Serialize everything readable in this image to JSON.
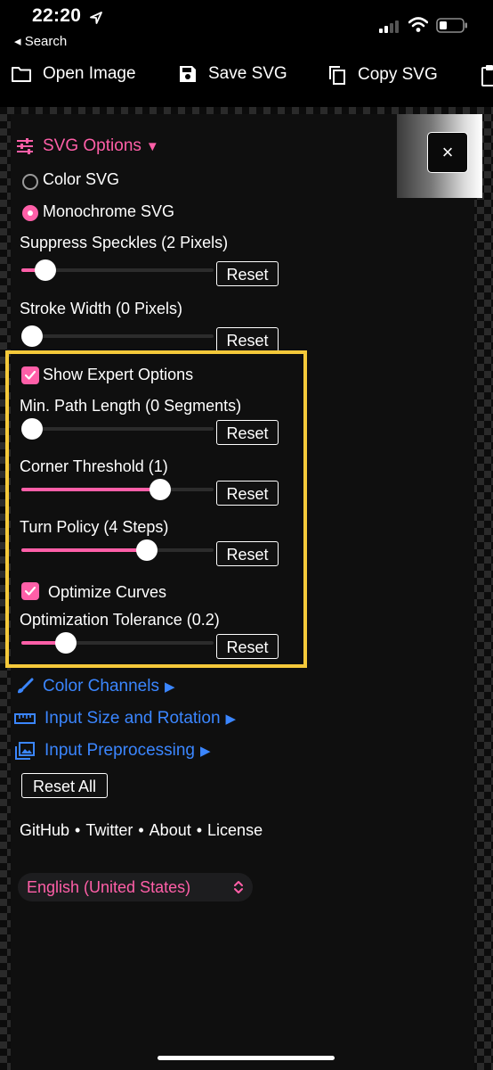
{
  "status_bar": {
    "time": "22:20",
    "back_label": "◂ Search"
  },
  "toolbar": {
    "open_image": "Open Image",
    "save_svg": "Save SVG",
    "copy_svg": "Copy SVG"
  },
  "svg_options": {
    "title": "SVG Options",
    "expand_glyph": "▼",
    "color_svg": "Color SVG",
    "monochrome_svg": "Monochrome SVG",
    "selected_mode": "Monochrome SVG",
    "close_glyph": "×",
    "suppress_speckles": {
      "label": "Suppress Speckles (2 Pixels)",
      "value_fraction": 0.08,
      "reset": "Reset"
    },
    "stroke_width": {
      "label": "Stroke Width (0 Pixels)",
      "value_fraction": 0.0,
      "reset": "Reset"
    },
    "show_expert": {
      "label": "Show Expert Options",
      "checked": true
    },
    "min_path_length": {
      "label": "Min. Path Length (0 Segments)",
      "value_fraction": 0.0,
      "reset": "Reset"
    },
    "corner_threshold": {
      "label": "Corner Threshold (1)",
      "value_fraction": 0.75,
      "reset": "Reset"
    },
    "turn_policy": {
      "label": "Turn Policy (4 Steps)",
      "value_fraction": 0.67,
      "reset": "Reset"
    },
    "optimize_curves": {
      "label": "Optimize Curves",
      "checked": true
    },
    "optimization_tolerance": {
      "label": "Optimization Tolerance (0.2)",
      "value_fraction": 0.2,
      "reset": "Reset"
    }
  },
  "sections": {
    "color_channels": "Color Channels",
    "input_size_rotation": "Input Size and Rotation",
    "input_preprocessing": "Input Preprocessing",
    "collapsed_glyph": "▶"
  },
  "reset_all": "Reset All",
  "footer": {
    "links": [
      "GitHub",
      "Twitter",
      "About",
      "License"
    ],
    "separator": "•"
  },
  "language": {
    "selected": "English (United States)"
  },
  "colors": {
    "accent": "#ff5fa8",
    "link_blue": "#3b86ff",
    "highlight": "#f5c93a"
  },
  "icons": {
    "status": [
      "location-arrow-icon",
      "signal-icon",
      "wifi-icon",
      "battery-icon"
    ],
    "toolbar": [
      "folder-icon",
      "save-icon",
      "copy-icon",
      "clipboard-icon"
    ],
    "sections": [
      "sliders-icon",
      "brush-icon",
      "ruler-icon",
      "image-icon"
    ],
    "select": "chevron-updown-icon"
  }
}
